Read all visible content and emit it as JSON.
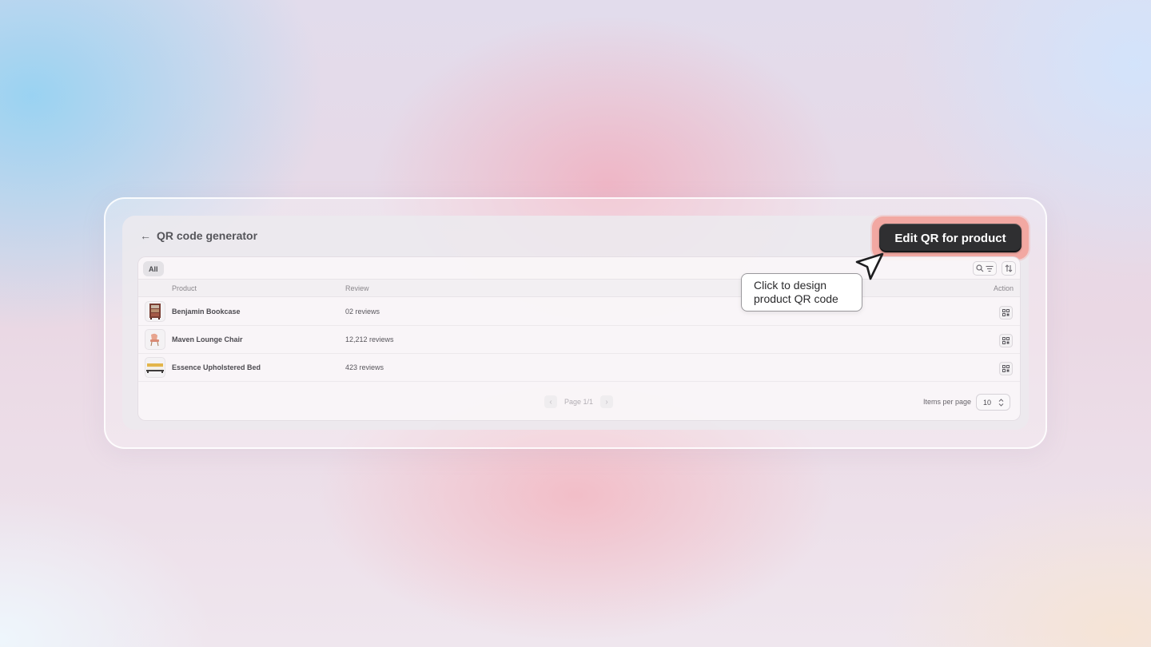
{
  "header": {
    "back_icon": "arrow-left-icon",
    "title": "QR code generator",
    "edit_button_label": "Edit QR for product"
  },
  "toolbar": {
    "tabs": [
      "All"
    ],
    "search_icon": "search-icon",
    "filter_icon": "filter-icon",
    "sort_icon": "sort-icon"
  },
  "table": {
    "columns": {
      "product": "Product",
      "review": "Review",
      "action": "Action"
    },
    "rows": [
      {
        "name": "Benjamin Bookcase",
        "reviews": "02 reviews",
        "thumb_icon": "bookcase-icon",
        "action_icon": "qr-code-icon"
      },
      {
        "name": "Maven Lounge Chair",
        "reviews": "12,212 reviews",
        "thumb_icon": "chair-icon",
        "action_icon": "qr-code-icon"
      },
      {
        "name": "Essence Upholstered Bed",
        "reviews": "423 reviews",
        "thumb_icon": "bed-icon",
        "action_icon": "qr-code-icon"
      }
    ]
  },
  "pagination": {
    "label": "Page 1/1",
    "items_per_page_label": "Items per page",
    "items_per_page_value": "10"
  },
  "tooltip": {
    "line1": "Click to design",
    "line2": "product QR code"
  },
  "colors": {
    "button_bg": "#2f2f31",
    "highlight_ring": "#f2a8a2"
  }
}
